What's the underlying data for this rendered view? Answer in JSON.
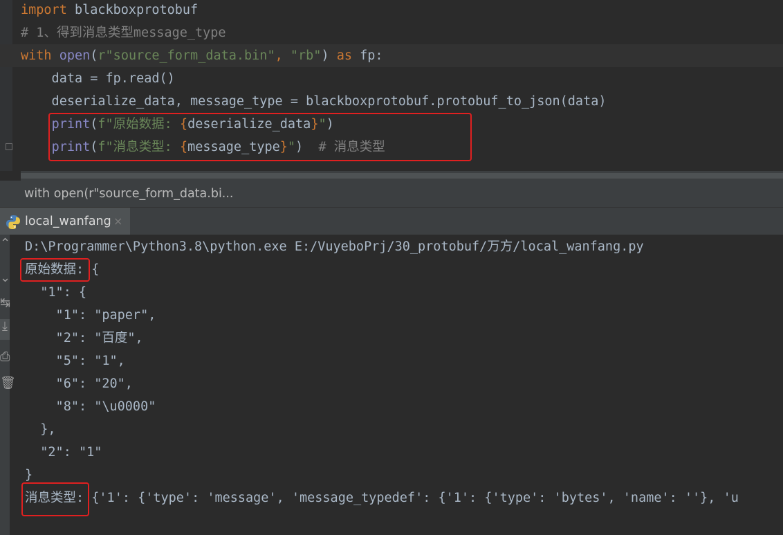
{
  "editor": {
    "line1": {
      "kw": "import",
      "rest": " blackboxprotobuf"
    },
    "line2": {
      "comment": "# 1、得到消息类型message_type"
    },
    "line3": {
      "kw_with": "with",
      "fn_open": "open",
      "p1": "(",
      "str_path": "r\"source_form_data.bin\"",
      "comma": ", ",
      "str_mode": "\"rb\"",
      "p2": ")",
      "kw_as": " as",
      "rest": " fp:"
    },
    "line4": {
      "text": "    data = fp.read()"
    },
    "line5": {
      "text": "    deserialize_data, message_type = blackboxprotobuf.protobuf_to_json(data)"
    },
    "line6": {
      "indent": "    ",
      "fn": "print",
      "p1": "(",
      "s1": "f\"原始数据: ",
      "b1": "{",
      "v": "deserialize_data",
      "b2": "}",
      "s2": "\"",
      "p2": ")"
    },
    "line7": {
      "indent": "    ",
      "fn": "print",
      "p1": "(",
      "s1": "f\"消息类型: ",
      "b1": "{",
      "v": "message_type",
      "b2": "}",
      "s2": "\"",
      "p2": ")",
      "comment": "  # 消息类型"
    }
  },
  "breadcrumb": {
    "text": "with open(r\"source_form_data.bi..."
  },
  "run_tab": {
    "label": "local_wanfang",
    "close": "×",
    "icon": "python-icon"
  },
  "console": {
    "lines": [
      "D:\\Programmer\\Python3.8\\python.exe E:/VuyeboPrj/30_protobuf/万方/local_wanfang.py",
      "原始数据: {",
      "  \"1\": {",
      "    \"1\": \"paper\",",
      "    \"2\": \"百度\",",
      "    \"5\": \"1\",",
      "    \"6\": \"20\",",
      "    \"8\": \"\\u0000\"",
      "  },",
      "  \"2\": \"1\"",
      "}",
      "消息类型: {'1': {'type': 'message', 'message_typedef': {'1': {'type': 'bytes', 'name': ''}, 'u"
    ],
    "gutter_glyphs": [
      "⌃",
      "⌄",
      "↹",
      "⤓",
      "⎙",
      "🗑"
    ]
  },
  "colors": {
    "background": "#2b2b2b",
    "keyword": "#cc7832",
    "string": "#6a8759",
    "comment": "#808080",
    "builtin": "#8888c6",
    "highlight_box": "#e02020"
  }
}
